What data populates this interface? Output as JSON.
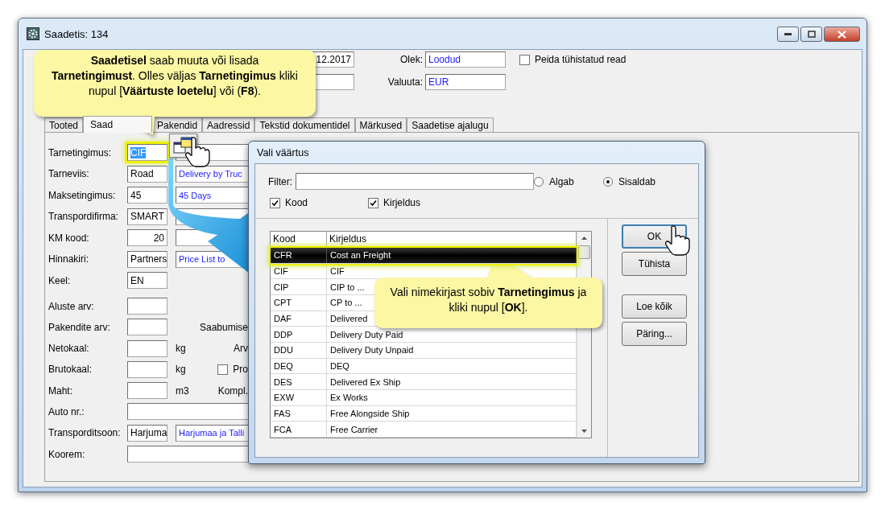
{
  "window": {
    "title": "Saadetis: 134"
  },
  "header_rows": [
    {
      "fields": [
        {
          "kind": "plain",
          "value": "12.2017"
        },
        {
          "kind": "lookup",
          "label": "Olek:",
          "value": "Loodud"
        }
      ],
      "checkbox": {
        "label": "Peida tühistatud read",
        "checked": false
      }
    },
    {
      "fields": [
        {
          "kind": "plain"
        },
        {
          "kind": "lookup",
          "label": "Valuuta:",
          "value": "EUR"
        }
      ]
    }
  ],
  "tabs": [
    {
      "label": "Tooted",
      "selected": false
    },
    {
      "label": "Saad",
      "selected": true
    },
    {
      "label": "Pakendid",
      "selected": false
    },
    {
      "label": "Aadressid",
      "selected": false
    },
    {
      "label": "Tekstid dokumentidel",
      "selected": false
    },
    {
      "label": "Märkused",
      "selected": false
    },
    {
      "label": "Saadetise ajalugu",
      "selected": false
    }
  ],
  "form_sections": [
    {
      "rows": [
        {
          "label": "Tarnetingimus:",
          "kind": "lookup",
          "value": "CIF",
          "highlighted": true
        },
        {
          "label": "Tarneviis:",
          "kind": "lookup",
          "value": "Road",
          "description": "Delivery by Truc",
          "highlighted": false
        },
        {
          "label": "Maksetingimus:",
          "kind": "lookup",
          "value": "45",
          "description": "45 Days",
          "highlighted": false
        },
        {
          "label": "Transpordifirma:",
          "kind": "lookup",
          "value": "SMART",
          "highlighted": false
        },
        {
          "label": "KM kood:",
          "kind": "numeric_lookup",
          "value": "20",
          "highlighted": false
        },
        {
          "label": "Hinnakiri:",
          "kind": "lookup",
          "value": "Partners",
          "description": "Price List to",
          "highlighted": false
        },
        {
          "label": "Keel:",
          "kind": "code",
          "value": "EN",
          "highlighted": false
        }
      ]
    },
    {
      "rows": [
        {
          "label": "Aluste arv:",
          "kind": "code"
        },
        {
          "label": "Pakendite arv:",
          "kind": "code",
          "note": "Saabumise"
        },
        {
          "label": "Netokaal:",
          "kind": "code",
          "unit": "kg",
          "note": "Arv"
        },
        {
          "label": "Brutokaal:",
          "kind": "code",
          "unit": "kg",
          "checkbox": {
            "label": "Pro",
            "checked": false
          }
        },
        {
          "label": "Maht:",
          "kind": "code",
          "unit": "m3",
          "note": "Kompl."
        },
        {
          "label": "Auto nr.:",
          "kind": "wide"
        },
        {
          "label": "Transporditsoon:",
          "kind": "lookup",
          "value": "Harjuma",
          "description": "Harjumaa ja Talli"
        },
        {
          "label": "Koorem:",
          "kind": "wide"
        }
      ]
    }
  ],
  "dialog": {
    "title": "Vali väärtus",
    "filter": {
      "label": "Filter:"
    },
    "match_options": [
      {
        "label": "Algab",
        "selected": false
      },
      {
        "label": "Sisaldab",
        "selected": true
      }
    ],
    "search_in": [
      {
        "label": "Kood",
        "checked": true
      },
      {
        "label": "Kirjeldus",
        "checked": true
      }
    ],
    "list": {
      "columns": [
        "Kood",
        "Kirjeldus"
      ],
      "rows": [
        {
          "code": "CFR",
          "description": "Cost an Freight",
          "selected": true
        },
        {
          "code": "CIF",
          "description": "CIF",
          "selected": false
        },
        {
          "code": "CIP",
          "description": "CIP to ...",
          "selected": false
        },
        {
          "code": "CPT",
          "description": "CP to ...",
          "selected": false
        },
        {
          "code": "DAF",
          "description": "Delivered",
          "selected": false
        },
        {
          "code": "DDP",
          "description": "Delivery Duty Paid",
          "selected": false
        },
        {
          "code": "DDU",
          "description": "Delivery Duty Unpaid",
          "selected": false
        },
        {
          "code": "DEQ",
          "description": "DEQ",
          "selected": false
        },
        {
          "code": "DES",
          "description": "Delivered Ex Ship",
          "selected": false
        },
        {
          "code": "EXW",
          "description": "Ex Works",
          "selected": false
        },
        {
          "code": "FAS",
          "description": "Free Alongside Ship",
          "selected": false
        },
        {
          "code": "FCA",
          "description": "Free Carrier",
          "selected": false
        }
      ]
    },
    "button_groups": [
      [
        "OK",
        "Tühista"
      ],
      [
        "Loe kõik",
        "Päring..."
      ]
    ]
  },
  "callouts": [
    {
      "text": "**Saadetisel** saab muuta või lisada **Tarnetingimust**. Olles väljas **Tarnetingimus** kliki nupul [**Väärtuste loetelu**] või (**F8**)."
    },
    {
      "text": "Vali nimekirjast sobiv **Tarnetingimus** ja kliki nupul [**OK**]."
    }
  ]
}
